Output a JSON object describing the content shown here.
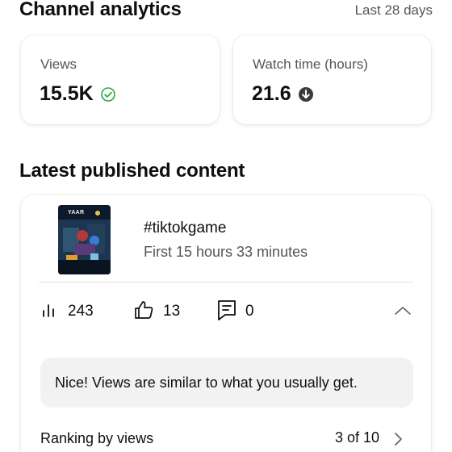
{
  "header": {
    "title": "Channel analytics",
    "range": "Last 28 days"
  },
  "stats": {
    "views": {
      "label": "Views",
      "value": "15.5K",
      "icon": "check-circle-icon"
    },
    "watch_time": {
      "label": "Watch time (hours)",
      "value": "21.6",
      "icon": "arrow-down-circle-icon"
    }
  },
  "latest": {
    "section_title": "Latest published content",
    "thumbnail_text": "YAAR",
    "video_title": "#tiktokgame",
    "video_subtitle": "First 15 hours 33 minutes",
    "metrics": {
      "views": "243",
      "likes": "13",
      "comments": "0"
    },
    "notice": "Nice! Views are similar to what you usually get.",
    "ranking_label": "Ranking by views",
    "ranking_value": "3 of 10"
  },
  "colors": {
    "text_primary": "#0f0f0f",
    "text_secondary": "#555555",
    "notice_bg": "#f2f2f2",
    "divider": "#e2e2e2"
  }
}
